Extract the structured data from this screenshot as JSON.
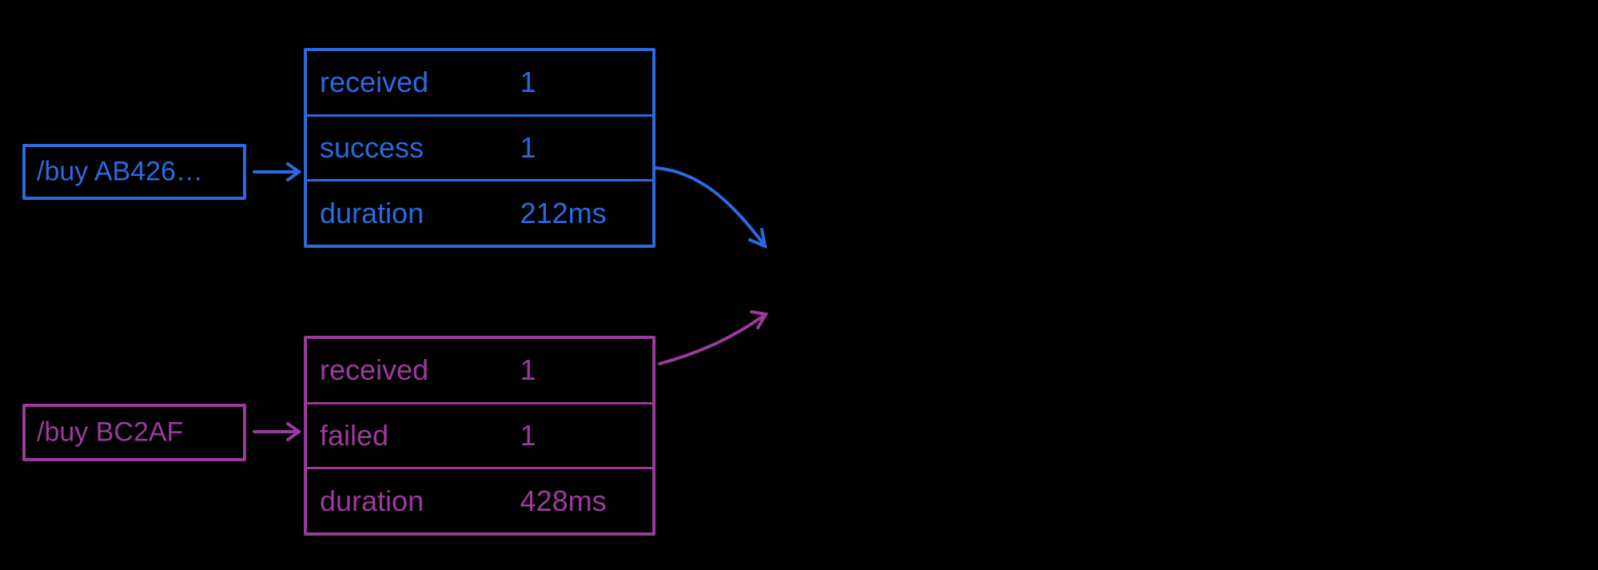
{
  "colors": {
    "blue": "#2a6ae0",
    "purple": "#9c3a9c"
  },
  "flows": [
    {
      "id": "flow-1",
      "color": "blue",
      "request": "/buy AB426…",
      "metrics": [
        {
          "key": "received",
          "value": "1"
        },
        {
          "key": "success",
          "value": "1"
        },
        {
          "key": "duration",
          "value": "212ms"
        }
      ]
    },
    {
      "id": "flow-2",
      "color": "purple",
      "request": "/buy BC2AF",
      "metrics": [
        {
          "key": "received",
          "value": "1"
        },
        {
          "key": "failed",
          "value": "1"
        },
        {
          "key": "duration",
          "value": "428ms"
        }
      ]
    }
  ]
}
